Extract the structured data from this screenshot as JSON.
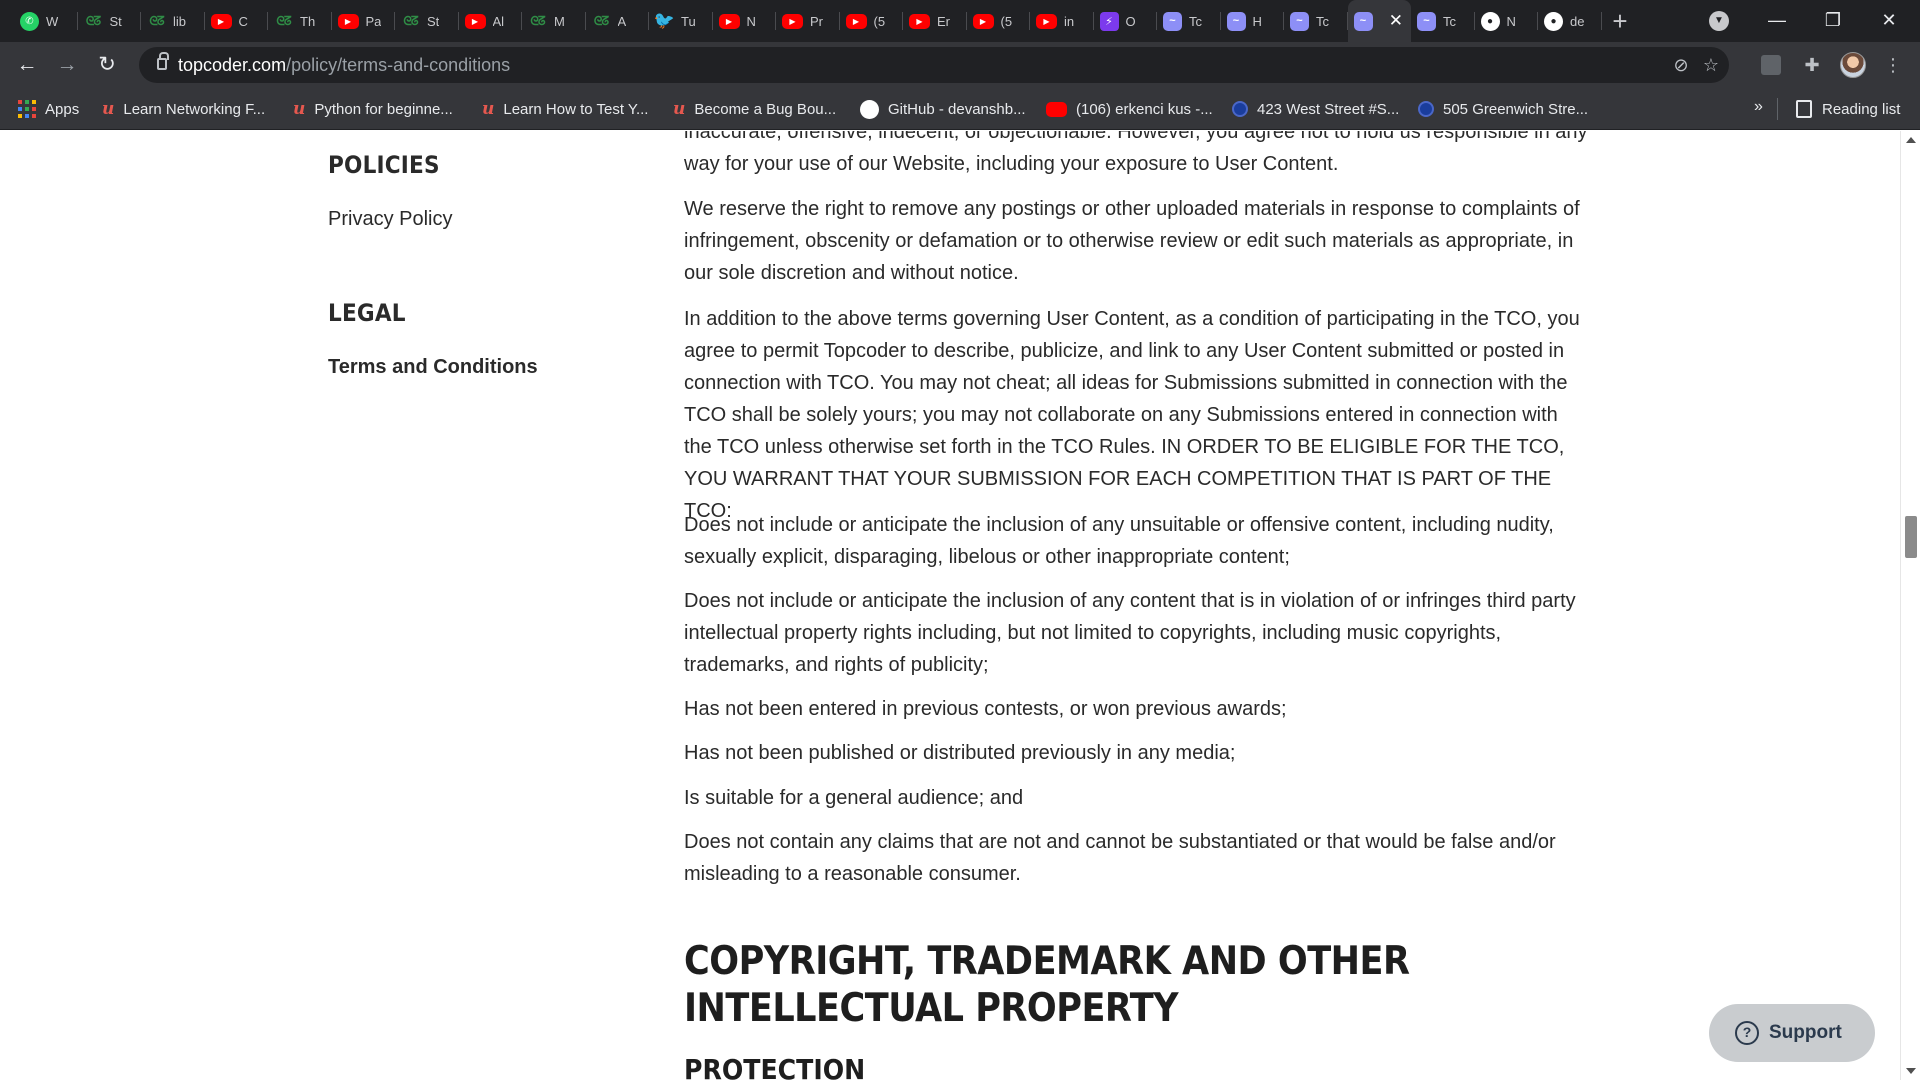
{
  "browser": {
    "tabs": [
      {
        "icon": "whatsapp-icon",
        "title": "W"
      },
      {
        "icon": "geeksforgeeks-icon",
        "title": "St"
      },
      {
        "icon": "geeksforgeeks-icon",
        "title": "lib"
      },
      {
        "icon": "youtube-icon",
        "title": "C"
      },
      {
        "icon": "geeksforgeeks-icon",
        "title": "Th"
      },
      {
        "icon": "youtube-icon",
        "title": "Pa"
      },
      {
        "icon": "geeksforgeeks-icon",
        "title": "St"
      },
      {
        "icon": "youtube-icon",
        "title": "Al"
      },
      {
        "icon": "geeksforgeeks-icon",
        "title": "M"
      },
      {
        "icon": "geeksforgeeks-icon",
        "title": "A"
      },
      {
        "icon": "twitter-icon",
        "title": "Tu"
      },
      {
        "icon": "youtube-icon",
        "title": "N"
      },
      {
        "icon": "youtube-icon",
        "title": "Pr"
      },
      {
        "icon": "youtube-icon",
        "title": "(5"
      },
      {
        "icon": "youtube-icon",
        "title": "Er"
      },
      {
        "icon": "youtube-icon",
        "title": "(5"
      },
      {
        "icon": "youtube-icon",
        "title": "in"
      },
      {
        "icon": "bolt-icon",
        "title": "O"
      },
      {
        "icon": "topcoder-icon",
        "title": "Tc"
      },
      {
        "icon": "topcoder-icon",
        "title": "H"
      },
      {
        "icon": "topcoder-icon",
        "title": "Tc"
      },
      {
        "icon": "topcoder-icon",
        "title": "",
        "active": true
      },
      {
        "icon": "topcoder-icon",
        "title": "Tc"
      },
      {
        "icon": "github-icon",
        "title": "N"
      },
      {
        "icon": "github-icon",
        "title": "de"
      }
    ],
    "address": {
      "host": "topcoder.com",
      "path": "/policy/terms-and-conditions"
    },
    "bookmarks": [
      {
        "icon": "apps-grid-icon",
        "label": "Apps"
      },
      {
        "icon": "udemy-icon",
        "label": "Learn Networking F..."
      },
      {
        "icon": "udemy-icon",
        "label": "Python for beginne..."
      },
      {
        "icon": "udemy-icon",
        "label": "Learn How to Test Y..."
      },
      {
        "icon": "udemy-icon",
        "label": "Become a Bug Bou..."
      },
      {
        "icon": "github-icon",
        "label": "GitHub - devanshb..."
      },
      {
        "icon": "youtube-icon",
        "label": "(106) erkenci kus -..."
      },
      {
        "icon": "map-pin-icon",
        "label": "423 West Street #S..."
      },
      {
        "icon": "map-pin-icon",
        "label": "505 Greenwich Stre..."
      }
    ],
    "bookmarks_overflow": "»",
    "reading_list": "Reading list"
  },
  "sidebar": {
    "policies_heading": "POLICIES",
    "privacy_link": "Privacy Policy",
    "legal_heading": "LEGAL",
    "terms_link": "Terms and Conditions"
  },
  "article": {
    "paragraphs": [
      "inaccurate, offensive, indecent, or objectionable. However, you agree not to hold us responsible in any way for your use of our Website, including your exposure to User Content.",
      "We reserve the right to remove any postings or other uploaded materials in response to complaints of infringement, obscenity or defamation or to otherwise review or edit such materials as appropriate, in our sole discretion and without notice.",
      "In addition to the above terms governing User Content, as a condition of participating in the TCO, you agree to permit Topcoder to describe, publicize, and link to any User Content submitted or posted in connection with TCO. You may not cheat; all ideas for Submissions submitted in connection with the TCO shall be solely yours; you may not collaborate on any Submissions entered in connection with the TCO unless otherwise set forth in the TCO Rules. IN ORDER TO BE ELIGIBLE FOR THE TCO, YOU WARRANT THAT YOUR SUBMISSION FOR EACH COMPETITION THAT IS PART OF THE TCO:",
      "Does not include or anticipate the inclusion of any unsuitable or offensive content, including nudity, sexually explicit, disparaging, libelous or other inappropriate content;",
      "Does not include or anticipate the inclusion of any content that is in violation of or infringes third party intellectual property rights including, but not limited to copyrights, including music copyrights, trademarks, and rights of publicity;",
      "Has not been entered in previous contests, or won previous awards;",
      "Has not been published or distributed previously in any media;",
      "Is suitable for a general audience; and",
      "Does not contain any claims that are not and cannot be substantiated or that would be false and/or misleading to a reasonable consumer."
    ],
    "section_heading": "COPYRIGHT, TRADEMARK AND OTHER INTELLECTUAL PROPERTY",
    "subsection_heading": "PROTECTION"
  },
  "support_button": "Support",
  "colors": {
    "chrome_dark": "#202124",
    "chrome_toolbar": "#35363a",
    "text": "#2a2a2a",
    "support_bg": "#c9cccf"
  }
}
